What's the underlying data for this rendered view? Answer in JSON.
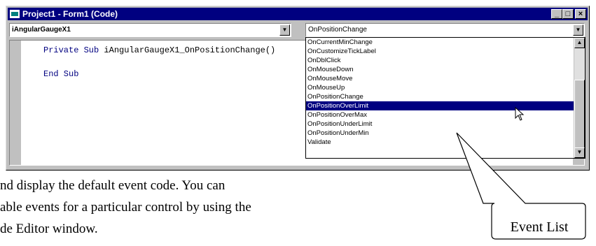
{
  "window": {
    "title": "Project1 - Form1 (Code)",
    "buttons": {
      "minimize": "_",
      "maximize": "□",
      "close": "×"
    }
  },
  "object_combo": {
    "value": "iAngularGaugeX1"
  },
  "procedure_combo": {
    "value": "OnPositionChange"
  },
  "code": {
    "line1_keyword": "Private Sub",
    "line1_name": " iAngularGaugeX1_OnPositionChange()",
    "line2": "End Sub"
  },
  "event_list": {
    "items": [
      "OnCurrentMinChange",
      "OnCustomizeTickLabel",
      "OnDblClick",
      "OnMouseDown",
      "OnMouseMove",
      "OnMouseUp",
      "OnPositionChange",
      "OnPositionOverLimit",
      "OnPositionOverMax",
      "OnPositionUnderLimit",
      "OnPositionUnderMin",
      "Validate"
    ],
    "selected": "OnPositionOverLimit"
  },
  "document": {
    "line1": "nd display the default event code.  You can",
    "line2": "able events for a particular control by using the",
    "line3": "de Editor window."
  },
  "callout": {
    "label": "Event List"
  },
  "colors": {
    "titlebar": "#000080",
    "selection": "#000080",
    "chrome": "#c0c0c0"
  }
}
